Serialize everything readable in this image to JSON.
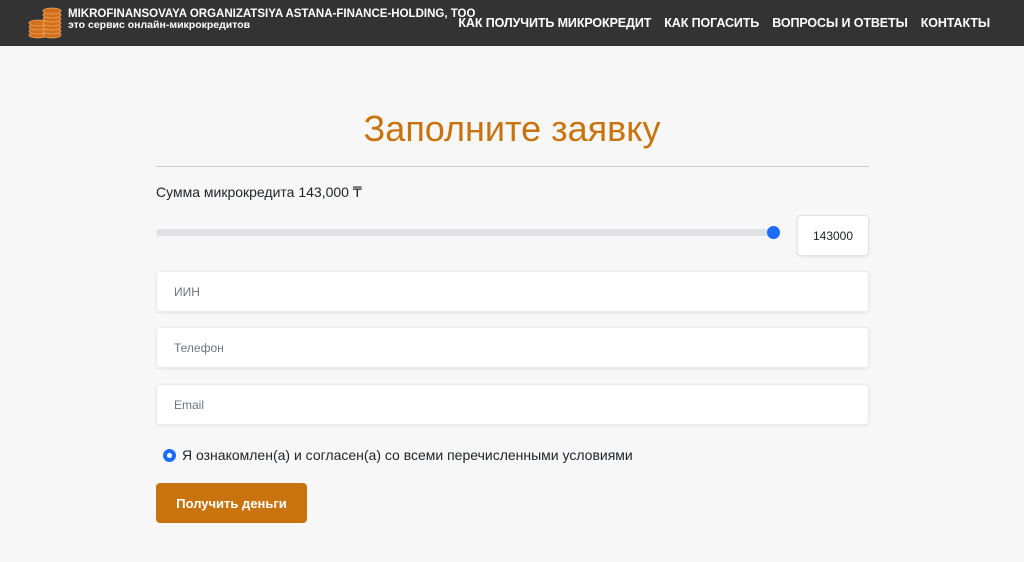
{
  "header": {
    "brand_title": "MIKROFINANSOVAYA ORGANIZATSIYA ASTANA-FINANCE-HOLDING, TOO",
    "brand_subtitle": "это сервис онлайн-микрокредитов",
    "logo_icon": "coin-stack-icon",
    "nav": [
      {
        "label": "КАК ПОЛУЧИТЬ МИКРОКРЕДИТ"
      },
      {
        "label": "КАК ПОГАСИТЬ"
      },
      {
        "label": "ВОПРОСЫ И ОТВЕТЫ"
      },
      {
        "label": "КОНТАКТЫ"
      }
    ]
  },
  "form": {
    "title": "Заполните заявку",
    "amount_label": "Сумма микрокредита 143,000 ₸",
    "slider": {
      "value": 143000,
      "fill_fraction": 1.0
    },
    "amount_value": "143000",
    "fields": [
      {
        "placeholder": "ИИН"
      },
      {
        "placeholder": "Телефон"
      },
      {
        "placeholder": "Email"
      }
    ],
    "agreement_label": "Я ознакомлен(а) и согласен(а) со всеми перечисленными условиями",
    "submit_label": "Получить деньги"
  },
  "colors": {
    "accent": "#c8730e",
    "header_bg": "#333333",
    "control_blue": "#1a6dff"
  }
}
